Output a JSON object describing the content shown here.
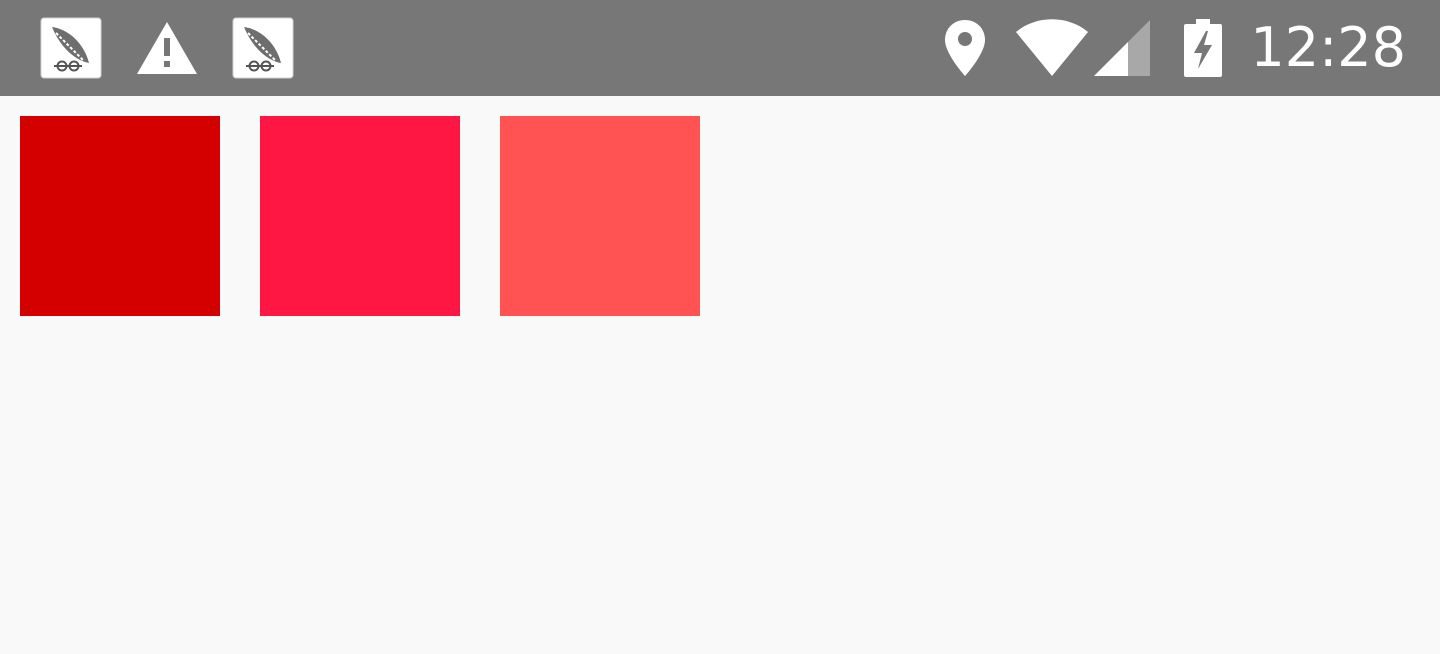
{
  "status_bar": {
    "background": "#777777",
    "time": "12:28",
    "notifications": [
      {
        "icon": "rocket-app-icon"
      },
      {
        "icon": "warning-icon"
      },
      {
        "icon": "rocket-app-icon"
      }
    ],
    "system_icons": [
      "location-icon",
      "wifi-icon",
      "cell-signal-icon",
      "battery-charging-icon"
    ]
  },
  "swatches": [
    {
      "color": "#d40000"
    },
    {
      "color": "#ff1744"
    },
    {
      "color": "#ff5252"
    }
  ],
  "background": "#f9f9f9"
}
